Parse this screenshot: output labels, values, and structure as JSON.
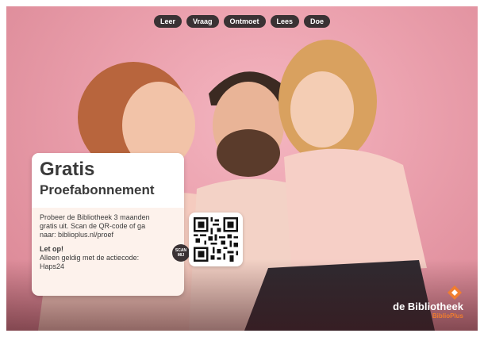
{
  "nav": {
    "items": [
      "Leer",
      "Vraag",
      "Ontmoet",
      "Lees",
      "Doe"
    ]
  },
  "card": {
    "title_main": "Gratis",
    "title_sub": "Proefabonnement",
    "body": "Probeer de Bibliotheek 3 maanden gratis uit. Scan de QR-code of ga naar: biblioplus.nl/proef",
    "note_title": "Let op!",
    "note_text": "Alleen geldig met de actiecode: Haps24"
  },
  "scan_badge": "SCAN MIJ",
  "logo": {
    "name": "de Bibliotheek",
    "sub": "BiblioPlus"
  },
  "colors": {
    "background_pink": "#ea9fac",
    "pill_dark": "#3a3234",
    "card_bg": "#fdf2ec",
    "logo_orange": "#f07d2e"
  }
}
